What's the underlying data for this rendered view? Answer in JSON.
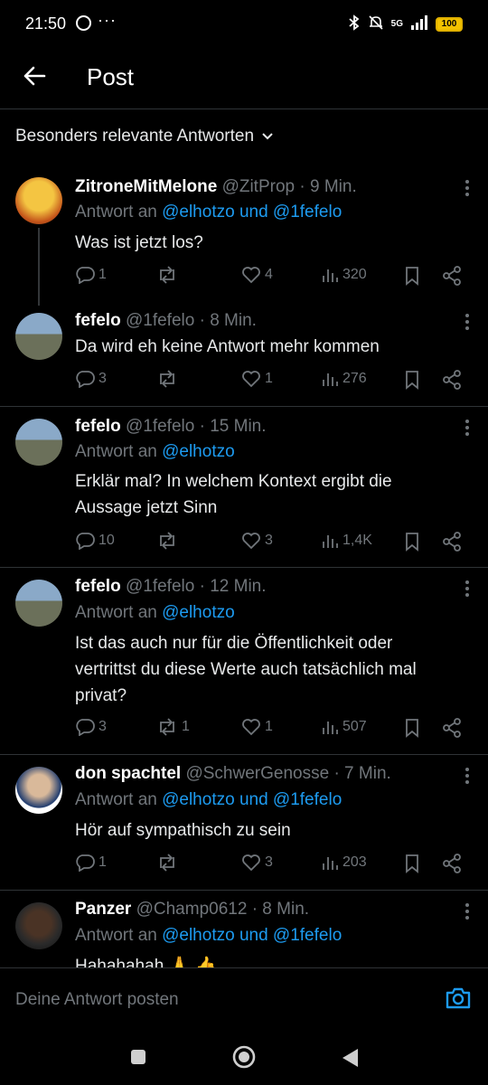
{
  "status": {
    "time": "21:50",
    "dots": "···",
    "network": "5G",
    "battery": "100"
  },
  "header": {
    "title": "Post"
  },
  "sort": {
    "label": "Besonders relevante Antworten"
  },
  "composer": {
    "placeholder": "Deine Antwort posten"
  },
  "tweets": [
    {
      "name": "ZitroneMitMelone",
      "handle": "@ZitProp",
      "time": "· 9 Min.",
      "reply_prefix": "Antwort an ",
      "reply_mentions": "@elhotzo und @1fefelo",
      "text": "Was ist jetzt los?",
      "replies": "1",
      "reposts": "",
      "likes": "4",
      "views": "320"
    },
    {
      "name": "fefelo",
      "handle": "@1fefelo",
      "time": "· 8 Min.",
      "reply_prefix": "",
      "reply_mentions": "",
      "text": "Da wird eh keine Antwort mehr kommen",
      "replies": "3",
      "reposts": "",
      "likes": "1",
      "views": "276"
    },
    {
      "name": "fefelo",
      "handle": "@1fefelo",
      "time": "· 15 Min.",
      "reply_prefix": "Antwort an ",
      "reply_mentions": "@elhotzo",
      "text": "Erklär mal? In welchem Kontext ergibt die Aussage jetzt Sinn",
      "replies": "10",
      "reposts": "",
      "likes": "3",
      "views": "1,4K"
    },
    {
      "name": "fefelo",
      "handle": "@1fefelo",
      "time": "· 12 Min.",
      "reply_prefix": "Antwort an ",
      "reply_mentions": "@elhotzo",
      "text": "Ist das auch nur für die Öffentlichkeit oder vertrittst du diese Werte auch tatsächlich mal privat?",
      "replies": "3",
      "reposts": "1",
      "likes": "1",
      "views": "507"
    },
    {
      "name": "don spachtel",
      "handle": "@SchwerGenosse",
      "time": "· 7 Min.",
      "reply_prefix": "Antwort an ",
      "reply_mentions": "@elhotzo und @1fefelo",
      "text": "Hör auf sympathisch zu sein",
      "replies": "1",
      "reposts": "",
      "likes": "3",
      "views": "203"
    },
    {
      "name": "Panzer",
      "handle": "@Champ0612",
      "time": "· 8 Min.",
      "reply_prefix": "Antwort an ",
      "reply_mentions": "@elhotzo und @1fefelo",
      "text": "Hahahahah 🙏 👍",
      "replies": "",
      "reposts": "",
      "likes": "",
      "views": ""
    }
  ],
  "icons": {
    "back": "back-arrow-icon",
    "chevron": "chevron-down-icon",
    "camera": "camera-icon"
  },
  "colors": {
    "accent": "#1d9bf0",
    "muted": "#71767b",
    "background": "#000000"
  }
}
